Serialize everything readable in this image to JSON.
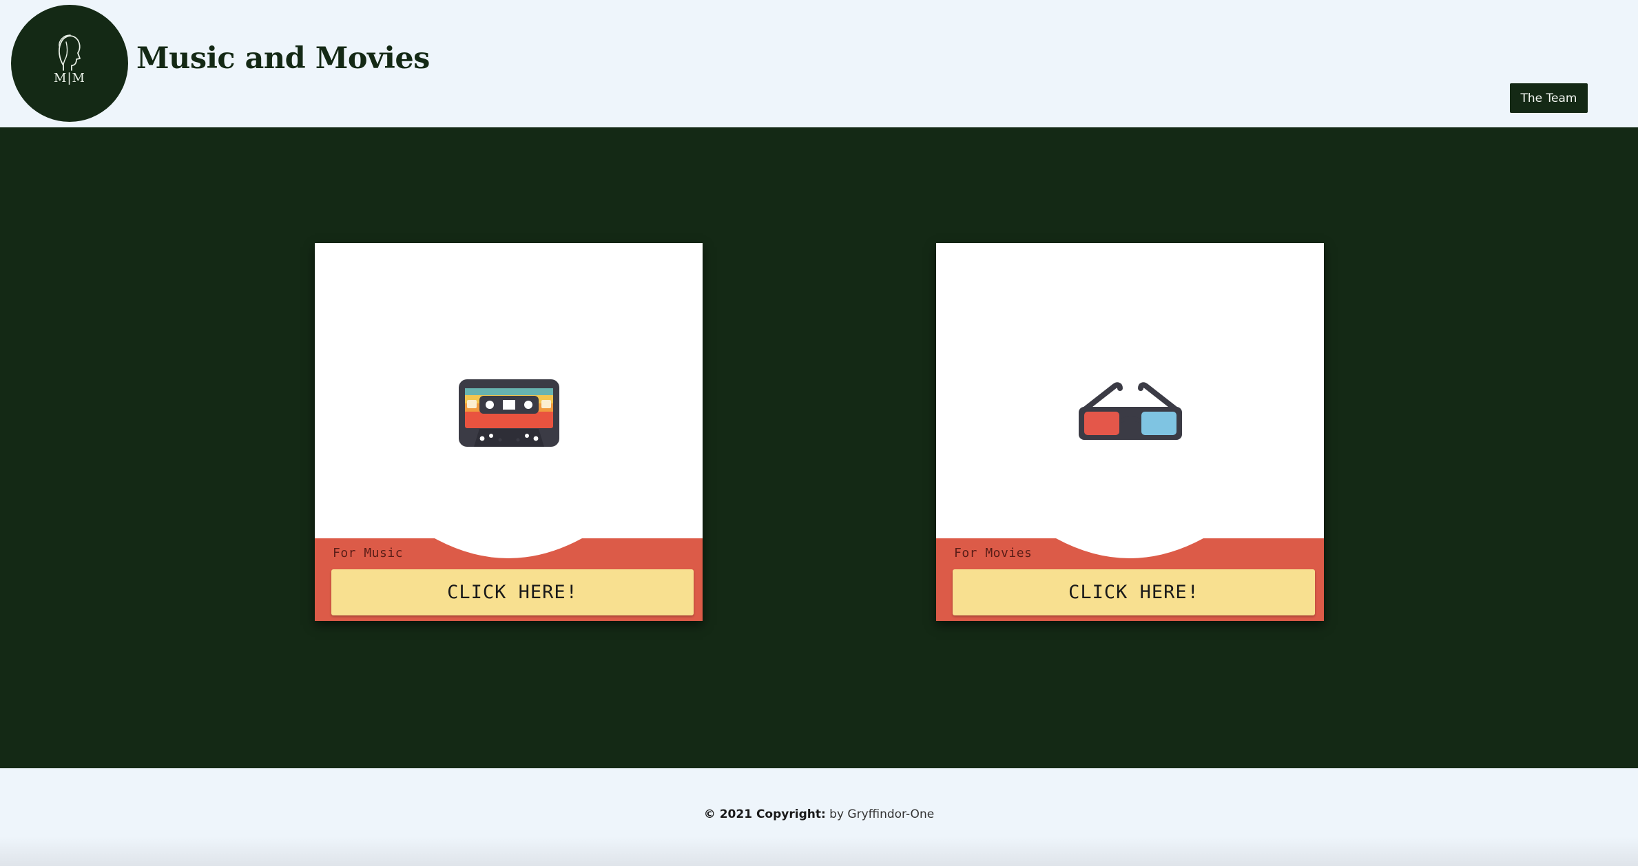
{
  "header": {
    "logo_text": "M|M",
    "title": "Music and Movies",
    "team_button_label": "The Team"
  },
  "cards": [
    {
      "label": "For Music",
      "button_label": "CLICK HERE!",
      "icon": "cassette-tape-icon"
    },
    {
      "label": "For Movies",
      "button_label": "CLICK HERE!",
      "icon": "3d-glasses-icon"
    }
  ],
  "footer": {
    "copyright_prefix": "© 2021 Copyright:",
    "copyright_suffix": " by Gryffindor-One"
  },
  "colors": {
    "header_bg": "#eef5fb",
    "main_bg": "#142915",
    "card_accent": "#dc5b48",
    "button_bg": "#f8e090"
  }
}
